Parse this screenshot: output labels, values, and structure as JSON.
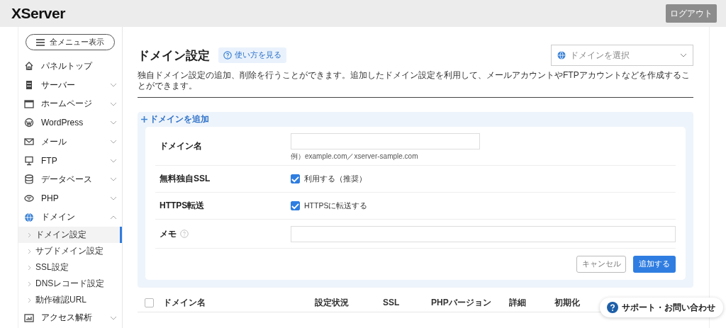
{
  "header": {
    "logo": "XServer",
    "logout": "ログアウト"
  },
  "sidebar": {
    "menu_button": "全メニュー表示",
    "items": [
      {
        "label": "パネルトップ",
        "kind": "link"
      },
      {
        "label": "サーバー",
        "kind": "group",
        "expanded": false
      },
      {
        "label": "ホームページ",
        "kind": "group",
        "expanded": false
      },
      {
        "label": "WordPress",
        "kind": "group",
        "expanded": false
      },
      {
        "label": "メール",
        "kind": "group",
        "expanded": false
      },
      {
        "label": "FTP",
        "kind": "group",
        "expanded": false
      },
      {
        "label": "データベース",
        "kind": "group",
        "expanded": false
      },
      {
        "label": "PHP",
        "kind": "group",
        "expanded": false
      },
      {
        "label": "ドメイン",
        "kind": "group",
        "expanded": true,
        "children": [
          {
            "label": "ドメイン設定",
            "selected": true
          },
          {
            "label": "サブドメイン設定",
            "selected": false
          },
          {
            "label": "SSL設定",
            "selected": false
          },
          {
            "label": "DNSレコード設定",
            "selected": false
          },
          {
            "label": "動作確認URL",
            "selected": false
          }
        ]
      },
      {
        "label": "アクセス解析",
        "kind": "group",
        "expanded": false
      }
    ]
  },
  "page": {
    "title": "ドメイン設定",
    "help_link": "使い方を見る",
    "domain_select": {
      "placeholder": "ドメインを選択"
    },
    "description": "独自ドメイン設定の追加、削除を行うことができます。追加したドメイン設定を利用して、メールアカウントやFTPアカウントなどを作成することができます。"
  },
  "add_form": {
    "heading": "ドメインを追加",
    "rows": [
      {
        "kind": "input",
        "label": "ドメイン名",
        "hint": "例）example.com／xserver-sample.com"
      },
      {
        "kind": "checkbox",
        "label": "無料独自SSL",
        "option": "利用する（推奨）",
        "checked": true
      },
      {
        "kind": "checkbox",
        "label": "HTTPS転送",
        "option": "HTTPSに転送する",
        "checked": true
      },
      {
        "kind": "input",
        "label": "メモ",
        "help": true
      }
    ],
    "cancel": "キャンセル",
    "submit": "追加する"
  },
  "table": {
    "columns": [
      "ドメイン名",
      "設定状況",
      "SSL",
      "PHPバージョン",
      "詳細",
      "初期化"
    ],
    "select_all": {
      "checked": false
    }
  },
  "support_button": "サポート・お問い合わせ"
}
